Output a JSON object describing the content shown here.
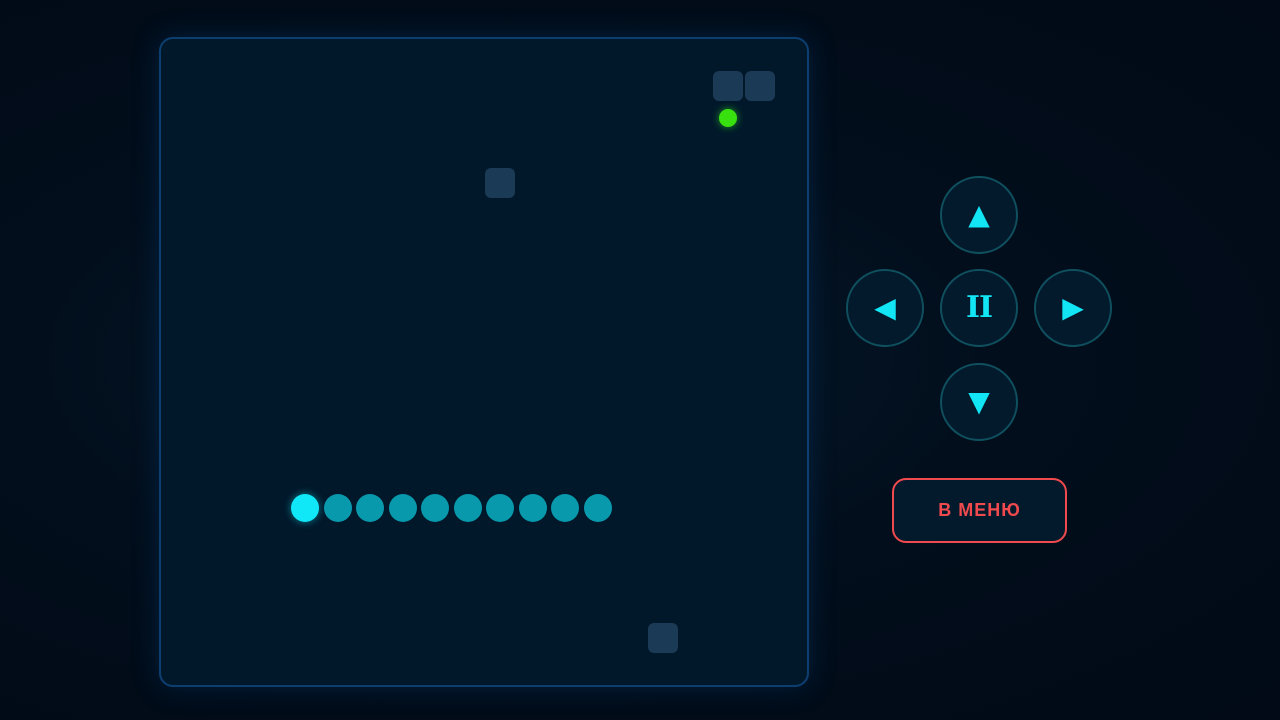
{
  "game": {
    "grid_cells": 20,
    "colors": {
      "food": "#39e00f",
      "snake_head": "#10e8f8",
      "snake_body": "#0899ad",
      "obstacle": "#1b3a55"
    },
    "food": {
      "col": 17,
      "row": 2
    },
    "obstacles": [
      {
        "col": 17,
        "row": 1
      },
      {
        "col": 18,
        "row": 1
      },
      {
        "col": 10,
        "row": 4
      },
      {
        "col": 15,
        "row": 18
      }
    ],
    "snake": [
      {
        "col": 4,
        "row": 14
      },
      {
        "col": 5,
        "row": 14
      },
      {
        "col": 6,
        "row": 14
      },
      {
        "col": 7,
        "row": 14
      },
      {
        "col": 8,
        "row": 14
      },
      {
        "col": 9,
        "row": 14
      },
      {
        "col": 10,
        "row": 14
      },
      {
        "col": 11,
        "row": 14
      },
      {
        "col": 12,
        "row": 14
      },
      {
        "col": 13,
        "row": 14
      }
    ]
  },
  "controls": {
    "up_glyph": "▲",
    "left_glyph": "◀",
    "pause_glyph": "II",
    "right_glyph": "▶",
    "down_glyph": "▼",
    "up_icon": "arrow-up-icon",
    "left_icon": "arrow-left-icon",
    "pause_icon": "pause-icon",
    "right_icon": "arrow-right-icon",
    "down_icon": "arrow-down-icon"
  },
  "menu_button": {
    "label": "В МЕНЮ",
    "color": "#f04a4e"
  }
}
